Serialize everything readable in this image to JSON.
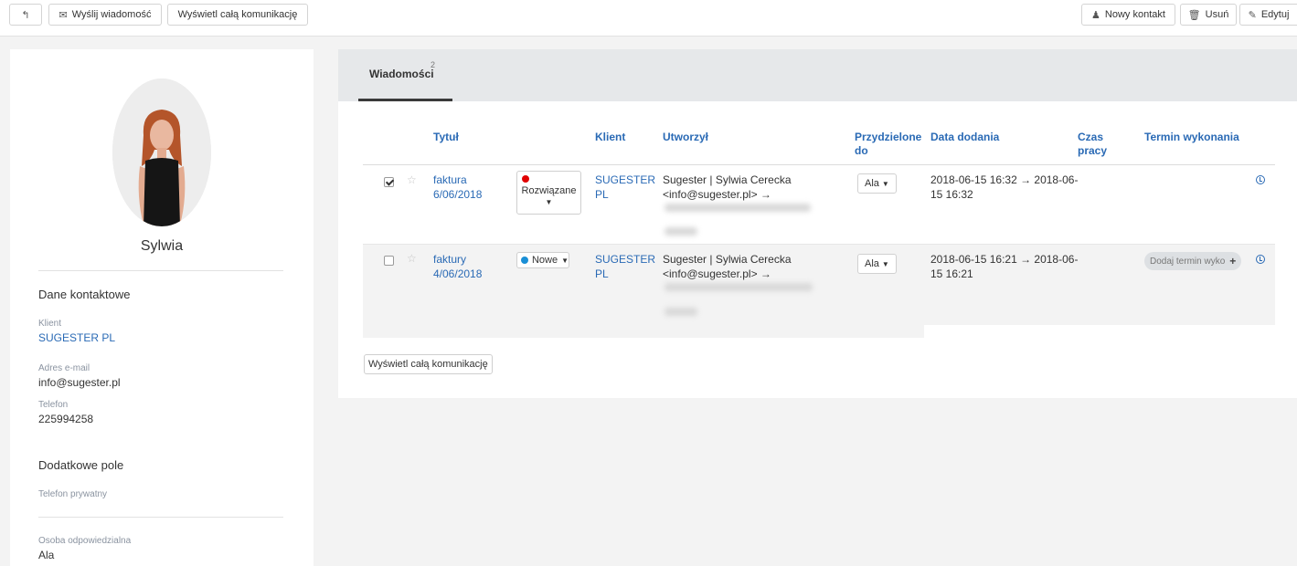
{
  "toolbar": {
    "back_icon": "reply-arrow-icon",
    "send_message": "Wyślij wiadomość",
    "send_icon": "envelope-icon",
    "show_all": "Wyświetl całą komunikację",
    "new_contact": "Nowy kontakt",
    "new_contact_icon": "user-icon",
    "delete": "Usuń",
    "delete_icon": "trash-icon",
    "edit": "Edytuj",
    "edit_icon": "pencil-icon"
  },
  "contact": {
    "name": "Sylwia",
    "contact_section": "Dane kontaktowe",
    "client_label": "Klient",
    "client_value": "SUGESTER PL",
    "email_label": "Adres e-mail",
    "email_value": "info@sugester.pl",
    "phone_label": "Telefon",
    "phone_value": "225994258",
    "extra_section": "Dodatkowe pole",
    "private_phone_label": "Telefon prywatny",
    "owner_label": "Osoba odpowiedzialna",
    "owner_value": "Ala"
  },
  "messages": {
    "tab_label": "Wiadomości",
    "tab_count": "2",
    "columns": {
      "title": "Tytuł",
      "client": "Klient",
      "author": "Utworzył",
      "assigned_1": "Przydzielone",
      "assigned_2": "do",
      "date_added": "Data dodania",
      "work_time_1": "Czas",
      "work_time_2": "pracy",
      "due": "Termin wykonania"
    },
    "rows": [
      {
        "checked": true,
        "title_1": "faktura",
        "title_2": "6/06/2018",
        "status": "Rozwiązane",
        "status_color": "#e00000",
        "client_1": "SUGESTER",
        "client_2": "PL",
        "author_1": "Sugester | Sylwia Cerecka",
        "author_2": "<info@sugester.pl> →",
        "assigned": "Ala",
        "date_1": "2018-06-15 16:32 → 2018-06-",
        "date_2": "15 16:32",
        "due": ""
      },
      {
        "checked": false,
        "title_1": "faktury",
        "title_2": "4/06/2018",
        "status": "Nowe",
        "status_color": "#1a8fd6",
        "client_1": "SUGESTER",
        "client_2": "PL",
        "author_1": "Sugester | Sylwia Cerecka",
        "author_2": "<info@sugester.pl> →",
        "assigned": "Ala",
        "date_1": "2018-06-15 16:21 → 2018-06-",
        "date_2": "15 16:21",
        "due": "Dodaj termin wyko"
      }
    ],
    "show_all": "Wyświetl całą komunikację"
  }
}
